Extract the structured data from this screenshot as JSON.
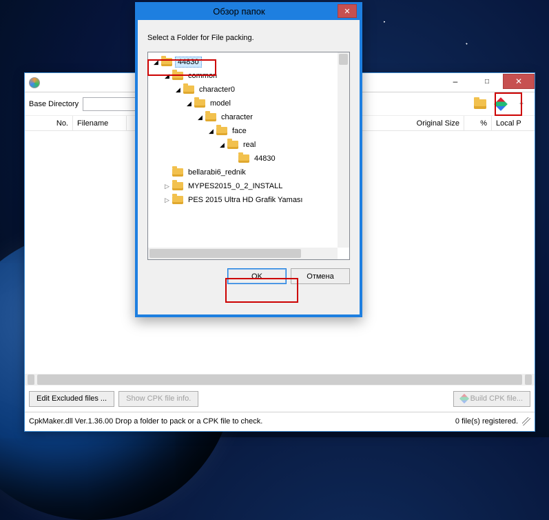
{
  "main": {
    "baseDirLabel": "Base Directory",
    "columns": {
      "no": "No.",
      "filename": "Filename",
      "origsize": "Original Size",
      "pct": "%",
      "localpath": "Local P"
    },
    "buttons": {
      "editExcluded": "Edit Excluded files ...",
      "showInfo": "Show CPK file info.",
      "build": "  Build CPK file..."
    },
    "status": {
      "left": "CpkMaker.dll Ver.1.36.00  Drop a folder to pack or a CPK file to check.",
      "right": "0 file(s) registered."
    }
  },
  "dialog": {
    "title": "Обзор папок",
    "message": "Select a Folder for File packing.",
    "tree": [
      {
        "indent": 0,
        "expanded": true,
        "label": "44830",
        "selected": true
      },
      {
        "indent": 1,
        "expanded": true,
        "label": "common"
      },
      {
        "indent": 2,
        "expanded": true,
        "label": "character0"
      },
      {
        "indent": 3,
        "expanded": true,
        "label": "model"
      },
      {
        "indent": 4,
        "expanded": true,
        "label": "character"
      },
      {
        "indent": 5,
        "expanded": true,
        "label": "face"
      },
      {
        "indent": 6,
        "expanded": true,
        "label": "real"
      },
      {
        "indent": 7,
        "expanded": null,
        "label": "44830"
      },
      {
        "indent": 1,
        "expanded": null,
        "label": "bellarabi6_rednik"
      },
      {
        "indent": 1,
        "expanded": false,
        "label": "MYPES2015_0_2_INSTALL"
      },
      {
        "indent": 1,
        "expanded": false,
        "label": "PES 2015 Ultra HD Grafik Yaması"
      }
    ],
    "ok": "OK",
    "cancel": "Отмена"
  }
}
